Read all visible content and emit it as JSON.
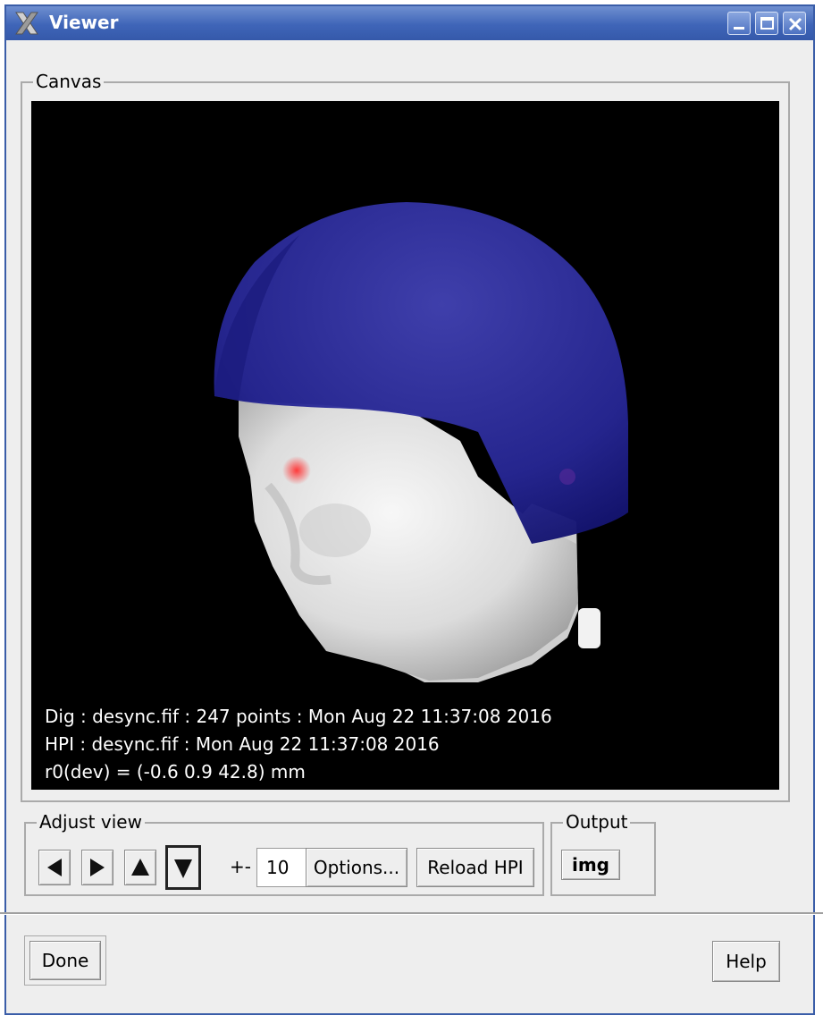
{
  "window": {
    "title": "Viewer",
    "icon": "x-logo-icon"
  },
  "canvas": {
    "legend": "Canvas",
    "info_lines": [
      "Dig : desync.fif : 247 points : Mon Aug 22 11:37:08 2016",
      "HPI : desync.fif : Mon Aug 22 11:37:08 2016",
      "r0(dev) = (-0.6 0.9 42.8) mm"
    ]
  },
  "adjust_view": {
    "legend": "Adjust view",
    "buttons": [
      "left-arrow",
      "right-arrow",
      "up-arrow",
      "down-arrow"
    ],
    "step_label": "+-",
    "step_value": "10",
    "options_label": "Options...",
    "reload_label": "Reload HPI"
  },
  "output": {
    "legend": "Output",
    "img_label": "img"
  },
  "footer": {
    "done_label": "Done",
    "help_label": "Help"
  },
  "colors": {
    "titlebar": "#3f65b8",
    "helmet": "#2a2a9a",
    "face": "#e6e6e6",
    "hpi_marker": "#ff3a3a"
  }
}
